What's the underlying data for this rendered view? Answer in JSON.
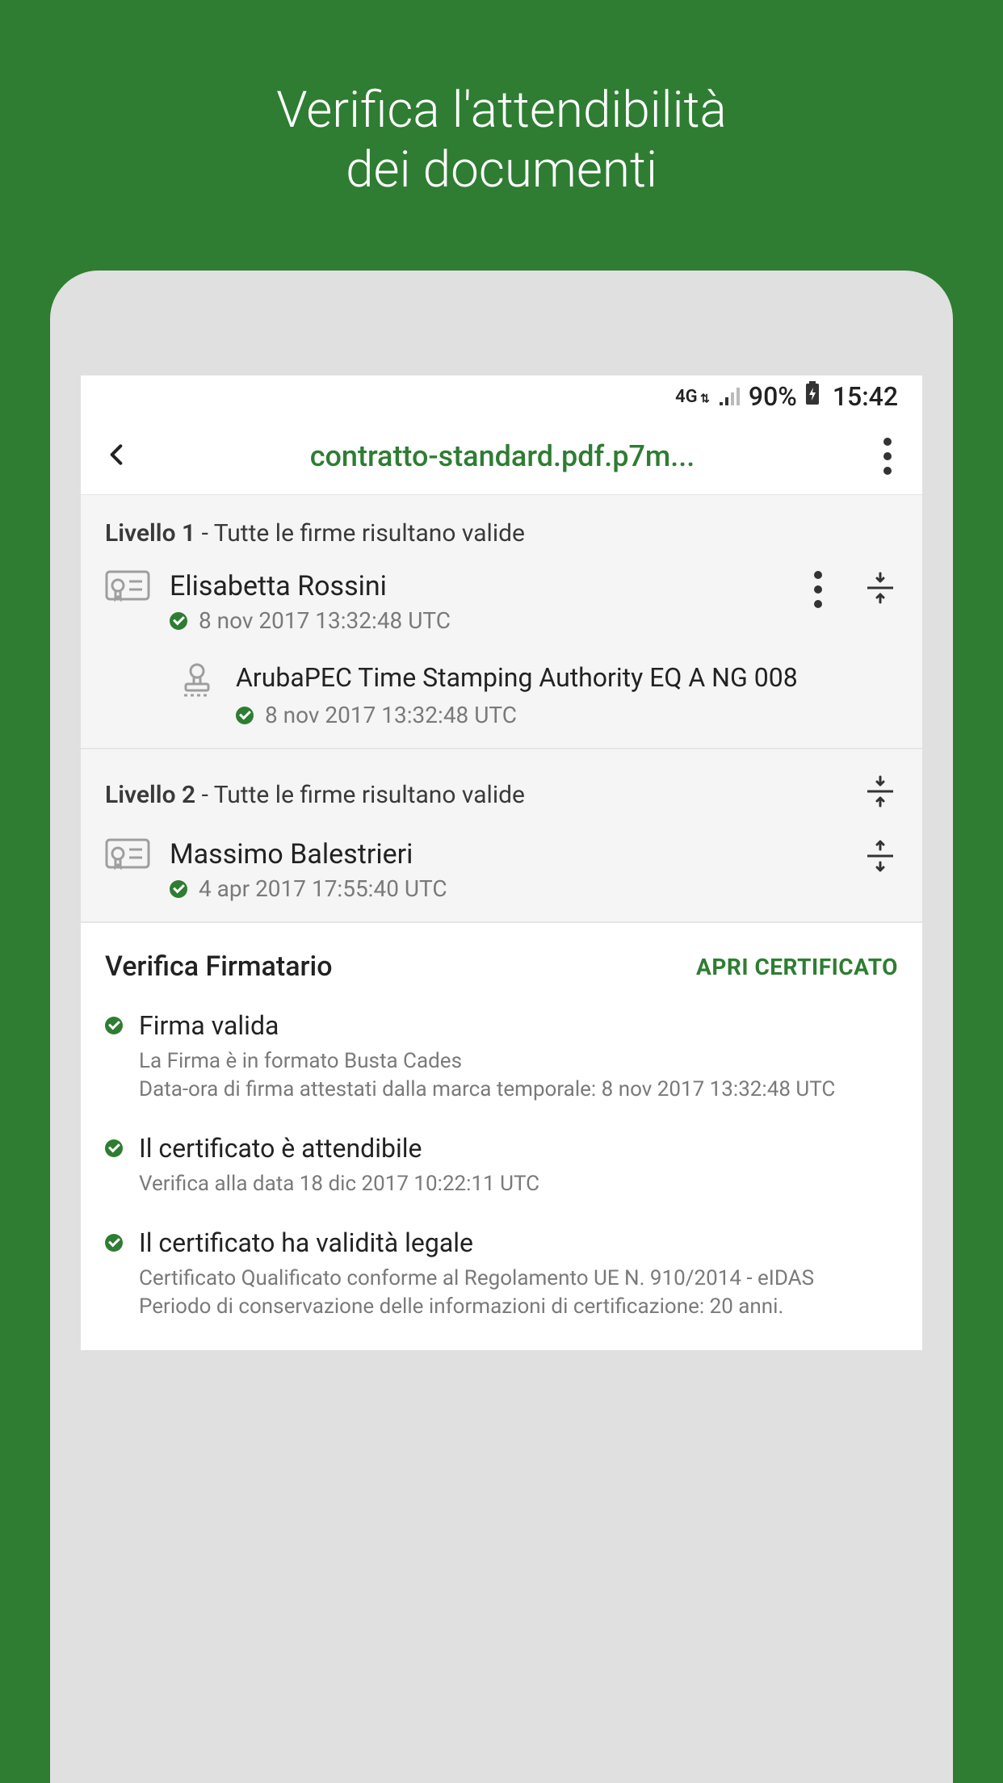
{
  "promo": {
    "line1": "Verifica l'attendibilità",
    "line2": "dei documenti"
  },
  "status_bar": {
    "network": "4G",
    "battery": "90%",
    "time": "15:42"
  },
  "app_bar": {
    "title": "contratto-standard.pdf.p7m..."
  },
  "levels": [
    {
      "label_bold": "Livello 1",
      "label_rest": " - Tutte le firme risultano valide",
      "signer_name": "Elisabetta Rossini",
      "signer_date": "8 nov 2017 13:32:48 UTC",
      "expanded": true,
      "tsa_name": "ArubaPEC Time Stamping Authority EQ A NG 008",
      "tsa_date": "8 nov 2017 13:32:48 UTC"
    },
    {
      "label_bold": "Livello 2",
      "label_rest": " - Tutte le firme risultano valide",
      "signer_name": "Massimo Balestrieri",
      "signer_date": "4 apr 2017 17:55:40 UTC",
      "expanded": false
    }
  ],
  "verify": {
    "title": "Verifica Firmatario",
    "open_cert": "APRI CERTIFICATO",
    "items": [
      {
        "title": "Firma valida",
        "desc": "La Firma è in formato Busta Cades\nData-ora di firma attestati dalla marca temporale: 8 nov 2017 13:32:48 UTC"
      },
      {
        "title": "Il certificato è attendibile",
        "desc": "Verifica alla data 18 dic 2017 10:22:11 UTC"
      },
      {
        "title": "Il certificato ha validità legale",
        "desc": "Certificato Qualificato conforme al Regolamento UE N. 910/2014 - eIDAS\nPeriodo di conservazione delle informazioni di certificazione: 20 anni."
      }
    ]
  }
}
